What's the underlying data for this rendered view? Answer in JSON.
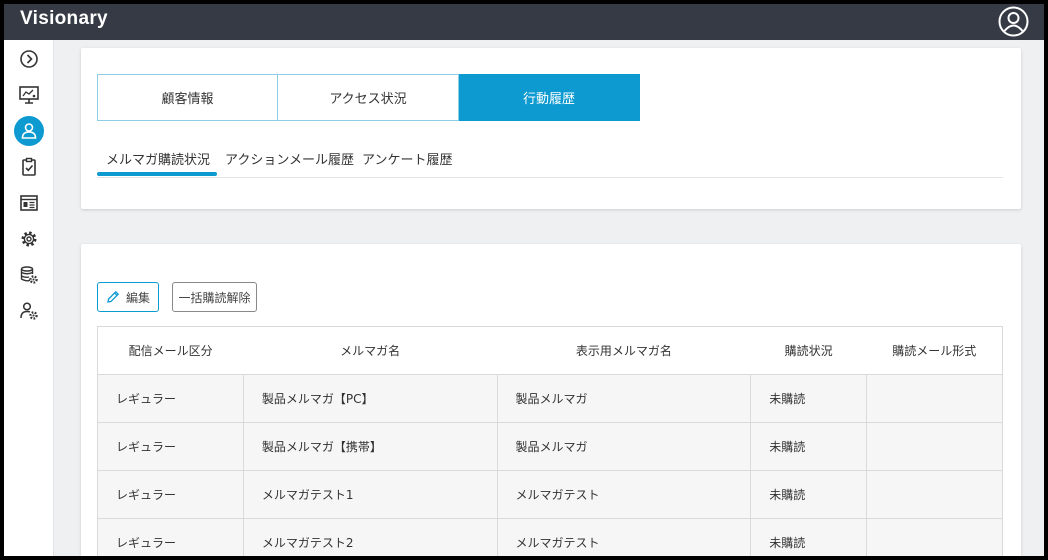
{
  "app": {
    "title": "Visionary"
  },
  "header": {
    "user_icon": "user-circle-icon"
  },
  "sidebar": {
    "items": [
      {
        "name": "expand",
        "icon": "chevron-right-circle-icon"
      },
      {
        "name": "monitor",
        "icon": "monitor-icon"
      },
      {
        "name": "customer",
        "icon": "user-icon",
        "active": true
      },
      {
        "name": "tasks",
        "icon": "clipboard-check-icon"
      },
      {
        "name": "content",
        "icon": "layout-icon"
      },
      {
        "name": "settings",
        "icon": "gear-icon"
      },
      {
        "name": "database",
        "icon": "database-gear-icon"
      },
      {
        "name": "admin",
        "icon": "user-gear-icon"
      }
    ]
  },
  "tabs": {
    "main": [
      {
        "label": "顧客情報"
      },
      {
        "label": "アクセス状況"
      },
      {
        "label": "行動履歴",
        "active": true
      }
    ],
    "sub": [
      {
        "label": "メルマガ購読状況",
        "active": true
      },
      {
        "label": "アクションメール履歴"
      },
      {
        "label": "アンケート履歴"
      }
    ]
  },
  "toolbar": {
    "edit_label": "編集",
    "bulk_unsubscribe_label": "一括購読解除"
  },
  "table": {
    "headers": [
      "配信メール区分",
      "メルマガ名",
      "表示用メルマガ名",
      "購読状況",
      "購読メール形式"
    ],
    "rows": [
      [
        "レギュラー",
        "製品メルマガ【PC】",
        "製品メルマガ",
        "未購読",
        ""
      ],
      [
        "レギュラー",
        "製品メルマガ【携帯】",
        "製品メルマガ",
        "未購読",
        ""
      ],
      [
        "レギュラー",
        "メルマガテスト1",
        "メルマガテスト",
        "未購読",
        ""
      ],
      [
        "レギュラー",
        "メルマガテスト2",
        "メルマガテスト",
        "未購読",
        ""
      ]
    ]
  },
  "colors": {
    "accent": "#0d9ad1",
    "topbar": "#353a45",
    "background": "#eff0f2"
  }
}
